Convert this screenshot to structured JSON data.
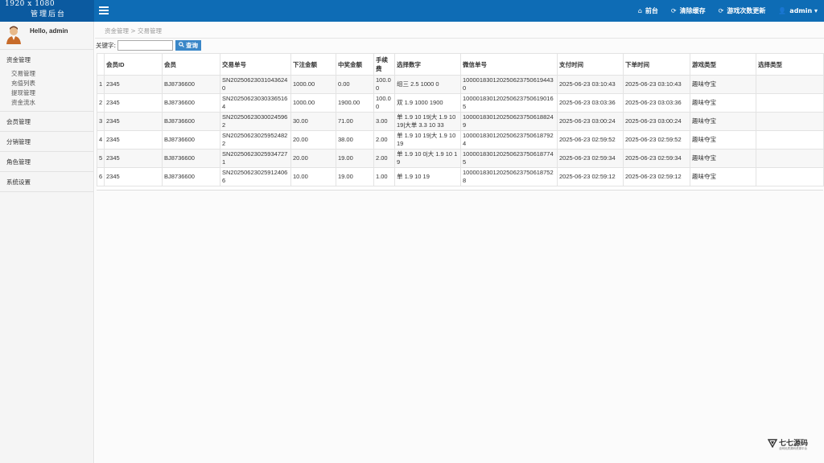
{
  "brand": {
    "resolution": "1920 x 1080",
    "name": "管理后台"
  },
  "nav": [
    {
      "icon": "home-icon",
      "glyph": "⌂",
      "label": "前台"
    },
    {
      "icon": "refresh-icon",
      "glyph": "⟳",
      "label": "清除缓存"
    },
    {
      "icon": "refresh-icon",
      "glyph": "⟳",
      "label": "游戏次数更新"
    },
    {
      "icon": "user-icon",
      "glyph": "👤",
      "label": "admin ▾"
    }
  ],
  "user": {
    "greeting": "Hello, admin"
  },
  "sidebar": {
    "groups": [
      {
        "title": "资金管理",
        "items": [
          "交易管理",
          "充值列表",
          "提现管理",
          "资金流水"
        ]
      },
      {
        "title": "会员管理",
        "items": []
      },
      {
        "title": "分销管理",
        "items": []
      },
      {
        "title": "角色管理",
        "items": []
      },
      {
        "title": "系统设置",
        "items": []
      }
    ]
  },
  "breadcrumb": "资金管理 > 交易管理",
  "search": {
    "label": "关键字:",
    "value": "",
    "placeholder": "",
    "button": "查询"
  },
  "table": {
    "columns": [
      "",
      "会员ID",
      "会员",
      "交易单号",
      "下注金额",
      "中奖金额",
      "手续费",
      "选择数字",
      "微信单号",
      "支付时间",
      "下单时间",
      "游戏类型",
      "选择类型"
    ],
    "rows": [
      [
        "1",
        "2345",
        "BJ8736600",
        "SN202506230310436240",
        "1000.00",
        "0.00",
        "100.00",
        "组三 2.5 1000 0",
        "100001830120250623750619443​0",
        "2025-06-23 03:10:43",
        "2025-06-23 03:10:43",
        "趣味夺宝",
        ""
      ],
      [
        "2",
        "2345",
        "BJ8736600",
        "SN202506230303365164",
        "1000.00",
        "1900.00",
        "100.00",
        "双 1.9 1000 1900",
        "1000018301202506237506190165",
        "2025-06-23 03:03:36",
        "2025-06-23 03:03:36",
        "趣味夺宝",
        ""
      ],
      [
        "3",
        "2345",
        "BJ8736600",
        "SN202506230300245962",
        "30.00",
        "71.00",
        "3.00",
        "单 1.9 10 19|大 1.9 10 19|大单 3.3 10 33",
        "1000018301202506237506188249",
        "2025-06-23 03:00:24",
        "2025-06-23 03:00:24",
        "趣味夺宝",
        ""
      ],
      [
        "4",
        "2345",
        "BJ8736600",
        "SN202506230259524822",
        "20.00",
        "38.00",
        "2.00",
        "单 1.9 10 19|大 1.9 10 19",
        "1000018301202506237506187924",
        "2025-06-23 02:59:52",
        "2025-06-23 02:59:52",
        "趣味夺宝",
        ""
      ],
      [
        "5",
        "2345",
        "BJ8736600",
        "SN202506230259347271",
        "20.00",
        "19.00",
        "2.00",
        "单 1.9 10 0|大 1.9 10 19",
        "1000018301202506237506187745",
        "2025-06-23 02:59:34",
        "2025-06-23 02:59:34",
        "趣味夺宝",
        ""
      ],
      [
        "6",
        "2345",
        "BJ8736600",
        "SN202506230259124066",
        "10.00",
        "19.00",
        "1.00",
        "单 1.9 10 19",
        "1000018301202506237506187528",
        "2025-06-23 02:59:12",
        "2025-06-23 02:59:12",
        "趣味夺宝",
        ""
      ]
    ]
  },
  "watermark": {
    "title": "七七源码",
    "subtitle": "全网优质源码资源平台"
  },
  "colors": {
    "topbar": "#0e6cb5",
    "brand_bg": "#0b5aa0",
    "button": "#3a87c8"
  }
}
